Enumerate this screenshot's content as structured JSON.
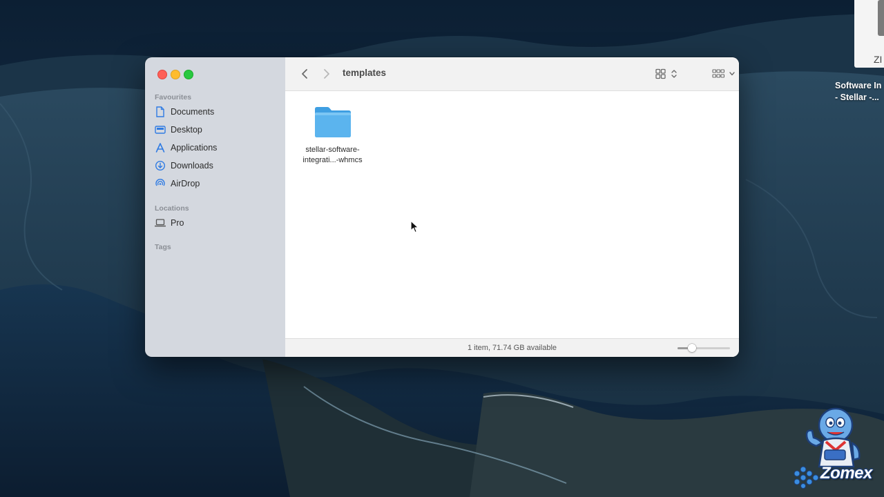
{
  "desktop": {
    "file": {
      "label_partial": "ZI",
      "name_line1": "Software In",
      "name_line2": "- Stellar -..."
    }
  },
  "finder": {
    "sidebar": {
      "favourites_heading": "Favourites",
      "favourites": [
        {
          "label": "Documents",
          "icon": "document-icon"
        },
        {
          "label": "Desktop",
          "icon": "desktop-icon"
        },
        {
          "label": "Applications",
          "icon": "applications-icon"
        },
        {
          "label": "Downloads",
          "icon": "downloads-icon"
        },
        {
          "label": "AirDrop",
          "icon": "airdrop-icon"
        }
      ],
      "locations_heading": "Locations",
      "locations": [
        {
          "label": "Pro",
          "icon": "laptop-icon"
        }
      ],
      "tags_heading": "Tags"
    },
    "toolbar": {
      "title": "templates"
    },
    "items": [
      {
        "name_line1": "stellar-software-",
        "name_line2": "integrati...-whmcs",
        "icon": "folder-icon"
      }
    ],
    "status": {
      "text": "1 item, 71.74 GB available",
      "icon_size_level": 0.27
    },
    "colors": {
      "accent": "#2b7be4",
      "folder": "#5bb4ee",
      "sidebar_icon": "#2f7be3"
    }
  },
  "watermark": {
    "brand": "Zomex"
  }
}
